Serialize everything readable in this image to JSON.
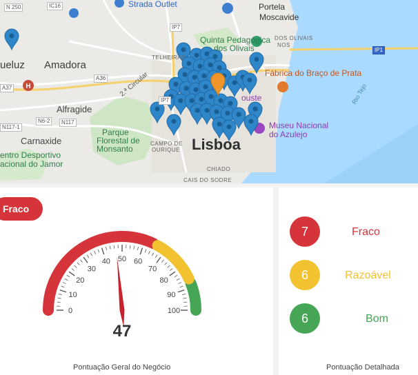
{
  "map": {
    "places": {
      "amadora": "Amadora",
      "lisboa": "Lisboa",
      "alfragide": "Alfragide",
      "carnaxide": "Carnaxide",
      "queluz": "ueluz",
      "portela": "Portela",
      "moscavide": "Moscavide",
      "telheiras": "TELHEIRAS",
      "olivais_nao": "DOS OLIVAIS",
      "caminhos": "NOS",
      "campo_ourique_1": "CAMPO DE",
      "campo_ourique_2": "OURIQUE",
      "cais_sodre": "CAIS DO SODRE",
      "chiado": "CHIADO",
      "ouste": "ouste",
      "rio_tejo": "Rio Tejo",
      "strada": "Strada Outlet",
      "quinta_1": "Quinta Pedagógica",
      "quinta_2": "dos Olivais",
      "fabrica": "Fábrica do Braço de Prata",
      "museu_1": "Museu Nacional",
      "museu_2": "do Azulejo",
      "parque_1": "Parque",
      "parque_2": "Florestal de",
      "parque_3": "Monsanto",
      "centro_1": "entro Desportivo",
      "centro_2": "acional do Jamor",
      "road_2a_circ": "2.ª Circular"
    },
    "shields": {
      "n250": "N 250",
      "ic16": "IC16",
      "ip7_top": "IP7",
      "ip7_mid": "IP7",
      "ip1": "IP1",
      "a37": "A37",
      "a36": "A36",
      "n6_2": "N6-2",
      "n117": "N117",
      "n117_1": "N117-1",
      "h": "H"
    }
  },
  "score": {
    "badge_label": "Fraco",
    "value": 47,
    "min": 0,
    "max": 100,
    "ticks": [
      "0",
      "10",
      "20",
      "30",
      "40",
      "50",
      "60",
      "70",
      "80",
      "90",
      "100"
    ],
    "caption": "Pontuação Geral do Negócio",
    "colors": {
      "red": "#d6343b",
      "yellow": "#f2c230",
      "green": "#46a656",
      "needle": "#c8232c"
    }
  },
  "detail": {
    "caption": "Pontuação Detalhada",
    "rows": [
      {
        "count": "7",
        "label": "Fraco",
        "color": "#d6343b"
      },
      {
        "count": "6",
        "label": "Razoável",
        "color": "#f2c230"
      },
      {
        "count": "6",
        "label": "Bom",
        "color": "#46a656"
      }
    ]
  }
}
